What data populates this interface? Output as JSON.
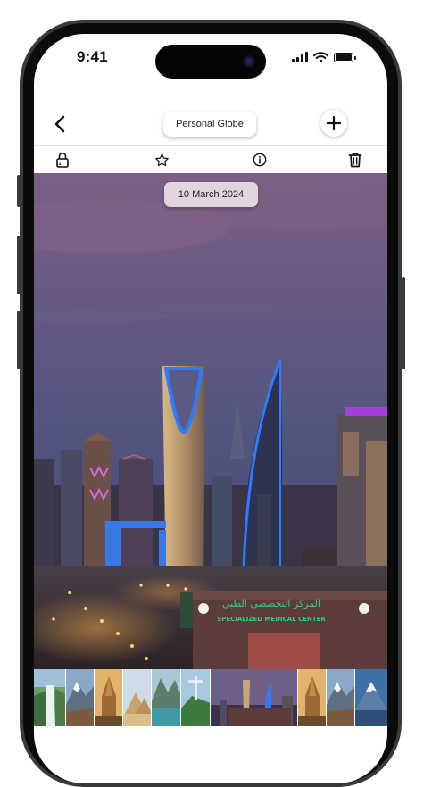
{
  "status_bar": {
    "time": "9:41"
  },
  "header": {
    "album_title": "Personal Globe"
  },
  "toolbar": {
    "icons": [
      "lock-icon",
      "star-icon",
      "info-icon",
      "trash-icon"
    ]
  },
  "photo": {
    "date": "10 March 2024",
    "signs": {
      "arabic": "المركز التخصصي الطبي",
      "english": "SPECIALIZED MEDICAL CENTER"
    }
  },
  "thumbnails": [
    {
      "subject": "waterfall"
    },
    {
      "subject": "snowy-mountain"
    },
    {
      "subject": "temple"
    },
    {
      "subject": "pyramids"
    },
    {
      "subject": "lake-mountains"
    },
    {
      "subject": "christ-statue"
    },
    {
      "subject": "city-skyline",
      "selected": true
    },
    {
      "subject": "temple"
    },
    {
      "subject": "snowy-mountain"
    },
    {
      "subject": "mountain-fuji"
    }
  ],
  "colors": {
    "accent_blue": "#2f7bff",
    "sign_green": "#35d07a"
  }
}
